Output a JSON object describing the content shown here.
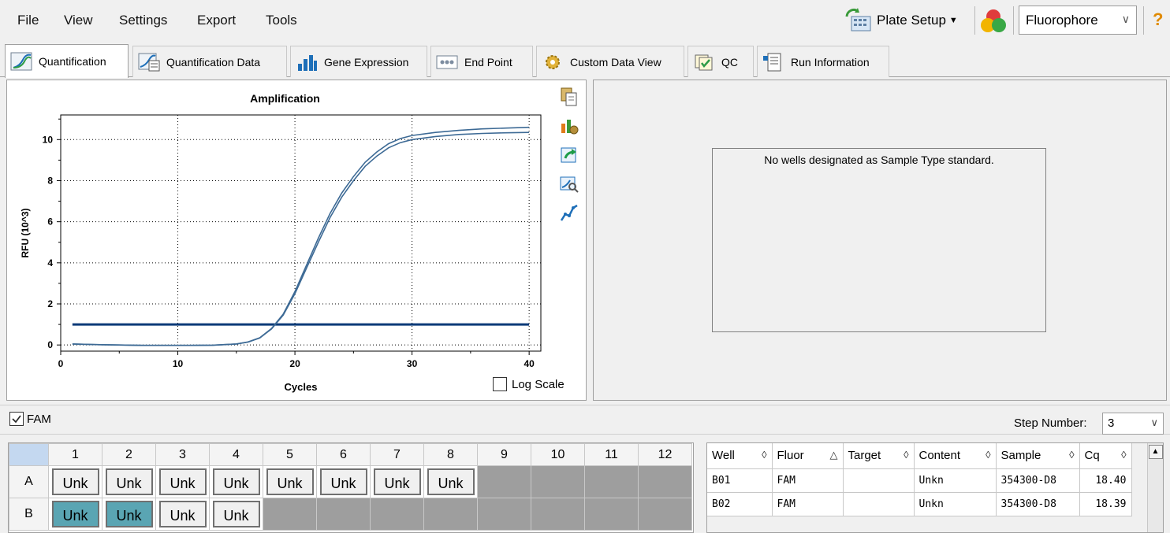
{
  "menu": {
    "file": "File",
    "view": "View",
    "settings": "Settings",
    "export": "Export",
    "tools": "Tools"
  },
  "toolbar": {
    "plate_setup": "Plate Setup",
    "fluorophore": "Fluorophore",
    "help_icon": "question-icon"
  },
  "tabs": [
    {
      "label": "Quantification"
    },
    {
      "label": "Quantification Data"
    },
    {
      "label": "Gene Expression"
    },
    {
      "label": "End Point"
    },
    {
      "label": "Custom Data View"
    },
    {
      "label": "QC"
    },
    {
      "label": "Run Information"
    }
  ],
  "chart_data": {
    "type": "line",
    "title": "Amplification",
    "xlabel": "Cycles",
    "ylabel": "RFU (10^3)",
    "xlim": [
      0,
      41
    ],
    "ylim": [
      -0.3,
      11.2
    ],
    "xticks": [
      0,
      10,
      20,
      30,
      40
    ],
    "yticks": [
      0,
      2,
      4,
      6,
      8,
      10
    ],
    "grid": true,
    "series": [
      {
        "x": [
          1,
          3,
          5,
          7,
          9,
          11,
          13,
          15,
          16,
          17,
          18,
          19,
          20,
          21,
          22,
          23,
          24,
          25,
          26,
          27,
          28,
          29,
          30,
          32,
          34,
          36,
          38,
          40
        ],
        "y": [
          0.05,
          0.02,
          0.0,
          -0.02,
          -0.02,
          -0.02,
          -0.01,
          0.05,
          0.15,
          0.35,
          0.8,
          1.5,
          2.6,
          3.9,
          5.2,
          6.4,
          7.4,
          8.2,
          8.9,
          9.4,
          9.8,
          10.05,
          10.2,
          10.35,
          10.45,
          10.52,
          10.56,
          10.6
        ]
      },
      {
        "x": [
          1,
          3,
          5,
          7,
          9,
          11,
          13,
          15,
          16,
          17,
          18,
          19,
          20,
          21,
          22,
          23,
          24,
          25,
          26,
          27,
          28,
          29,
          30,
          32,
          34,
          36,
          38,
          40
        ],
        "y": [
          0.05,
          0.02,
          0.0,
          -0.02,
          -0.02,
          -0.02,
          -0.01,
          0.05,
          0.14,
          0.34,
          0.78,
          1.45,
          2.5,
          3.75,
          5.0,
          6.2,
          7.2,
          8.0,
          8.7,
          9.2,
          9.6,
          9.85,
          10.0,
          10.15,
          10.25,
          10.3,
          10.33,
          10.35
        ]
      }
    ],
    "threshold": {
      "y": 1.0,
      "x_range": [
        1,
        40
      ]
    }
  },
  "log_scale_label": "Log Scale",
  "standard_message": "No wells designated as Sample Type standard.",
  "fam_label": "FAM",
  "step": {
    "label": "Step Number:",
    "value": "3"
  },
  "plate": {
    "columns": [
      "1",
      "2",
      "3",
      "4",
      "5",
      "6",
      "7",
      "8",
      "9",
      "10",
      "11",
      "12"
    ],
    "rows": [
      {
        "label": "A",
        "wells": [
          "Unk",
          "Unk",
          "Unk",
          "Unk",
          "Unk",
          "Unk",
          "Unk",
          "Unk",
          "",
          "",
          "",
          ""
        ]
      },
      {
        "label": "B",
        "wells": [
          "Unk",
          "Unk",
          "Unk",
          "Unk",
          "",
          "",
          "",
          "",
          "",
          "",
          "",
          ""
        ]
      }
    ],
    "selected": [
      "B1",
      "B2"
    ]
  },
  "results": {
    "headers": [
      "Well",
      "Fluor",
      "Target",
      "Content",
      "Sample",
      "Cq"
    ],
    "rows": [
      [
        "B01",
        "FAM",
        "",
        "Unkn",
        "354300-D8",
        "18.40"
      ],
      [
        "B02",
        "FAM",
        "",
        "Unkn",
        "354300-D8",
        "18.39"
      ]
    ]
  },
  "colors": {
    "curve": "#3d6a95",
    "threshold": "#0b3a78",
    "selected_well": "#5aa5b3"
  }
}
